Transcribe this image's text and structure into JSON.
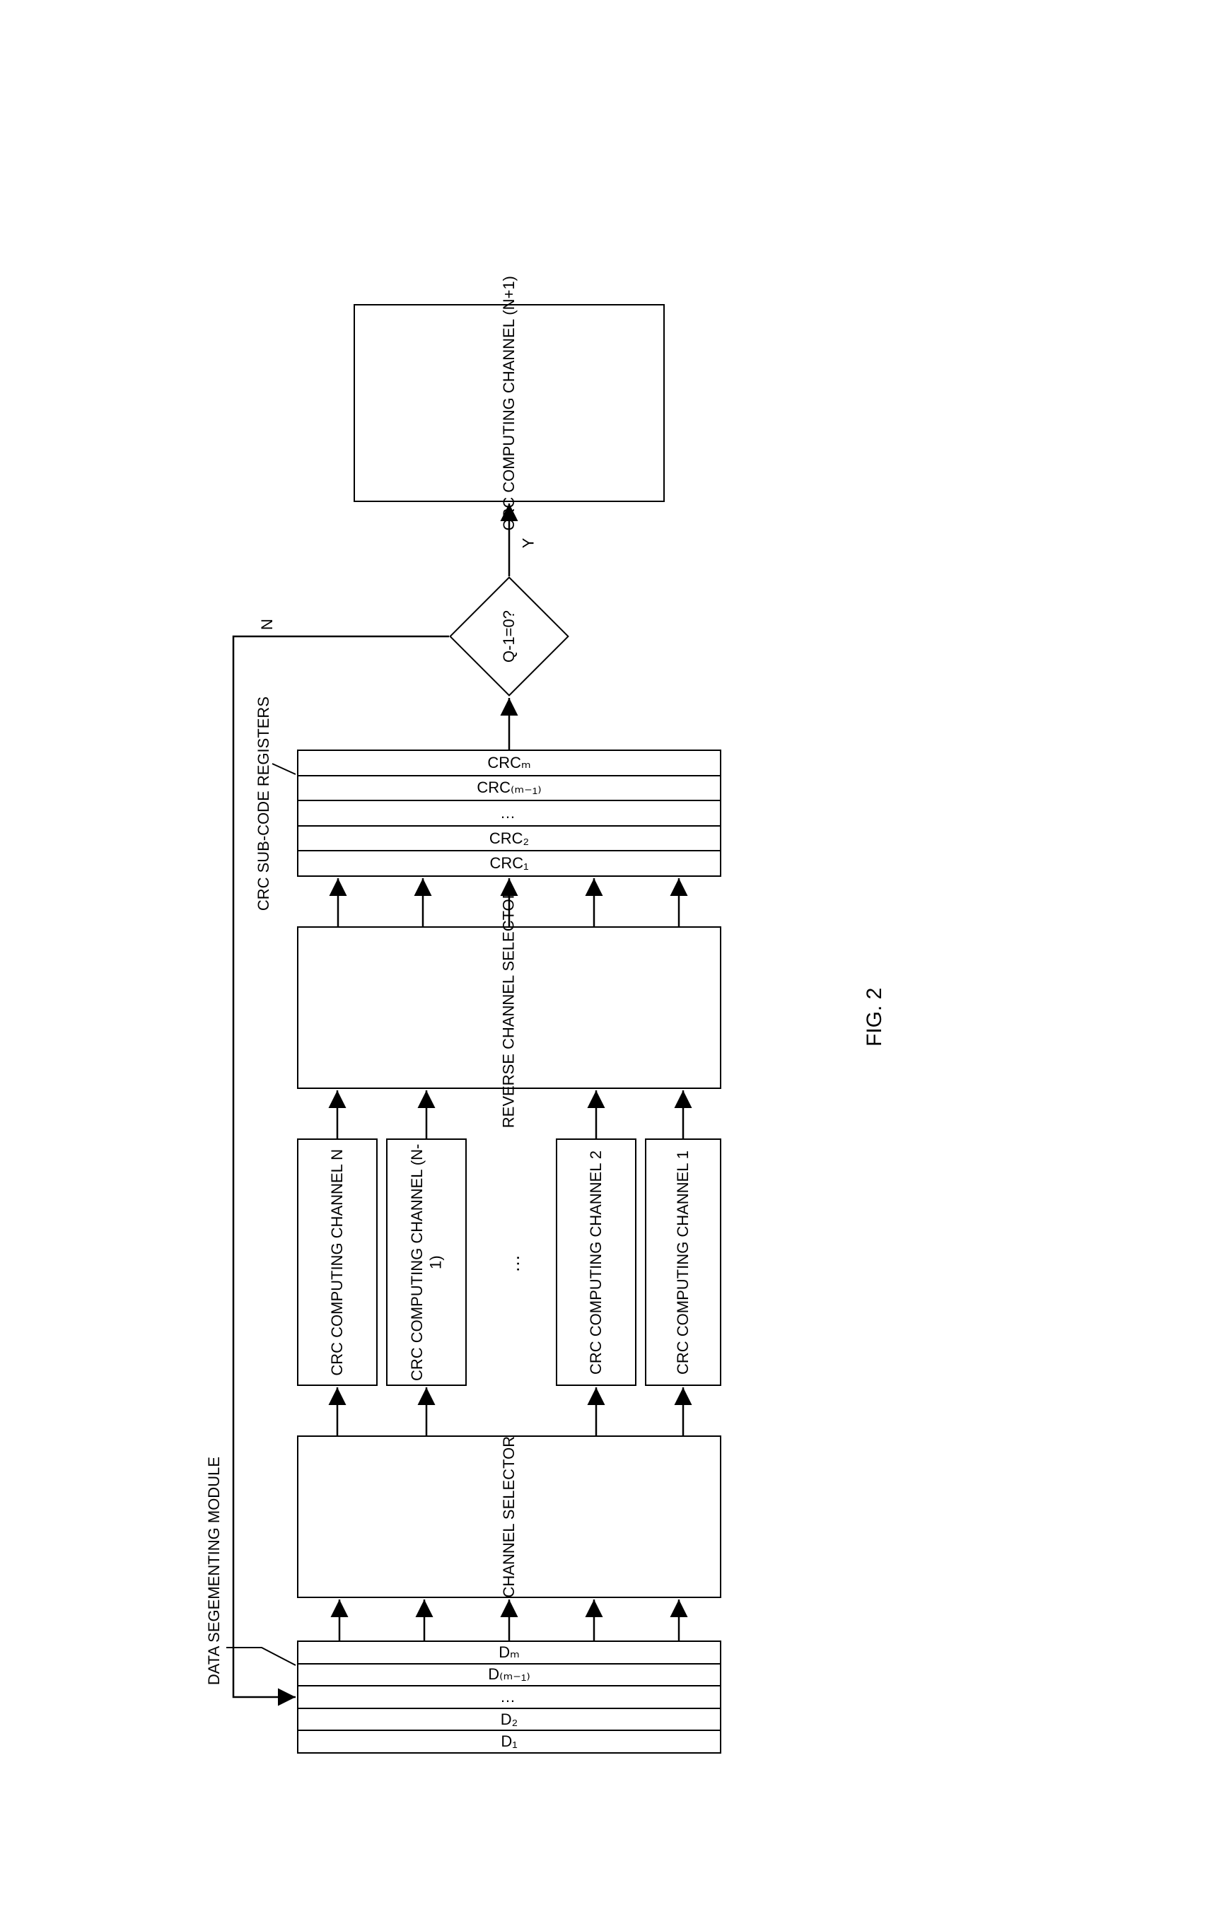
{
  "figure_caption": "FIG. 2",
  "module_label": "DATA SEGEMENTING MODULE",
  "registers_label": "CRC SUB-CODE REGISTERS",
  "data_segments": {
    "items": [
      "Dₘ",
      "D₍ₘ₋₁₎",
      "…",
      "D₂",
      "D₁"
    ]
  },
  "channel_selector": "CHANNEL SELECTOR",
  "reverse_channel_selector": "REVERSE CHANNEL SELECTOR",
  "crc_channels": {
    "items": [
      "CRC COMPUTING CHANNEL N",
      "CRC COMPUTING CHANNEL (N-1)",
      "…",
      "CRC COMPUTING CHANNEL 2",
      "CRC COMPUTING CHANNEL 1"
    ]
  },
  "crc_subcodes": {
    "items": [
      "CRCₘ",
      "CRC₍ₘ₋₁₎",
      "…",
      "CRC₂",
      "CRC₁"
    ]
  },
  "decision": "Q-1=0?",
  "branch_no": "N",
  "branch_yes": "Y",
  "final_channel": "CRC COMPUTING CHANNEL (N+1)",
  "chart_data": {
    "type": "flow-diagram",
    "nodes": [
      {
        "id": "segments",
        "label": "Data segmenting module",
        "items": [
          "D_m",
          "D_(m-1)",
          "...",
          "D_2",
          "D_1"
        ]
      },
      {
        "id": "selector",
        "label": "CHANNEL SELECTOR"
      },
      {
        "id": "channels",
        "label": "CRC computing channels",
        "items": [
          "N",
          "N-1",
          "...",
          "2",
          "1"
        ]
      },
      {
        "id": "rev_selector",
        "label": "REVERSE CHANNEL SELECTOR"
      },
      {
        "id": "registers",
        "label": "CRC sub-code registers",
        "items": [
          "CRC_m",
          "CRC_(m-1)",
          "...",
          "CRC_2",
          "CRC_1"
        ]
      },
      {
        "id": "decision",
        "label": "Q-1=0?"
      },
      {
        "id": "final",
        "label": "CRC COMPUTING CHANNEL (N+1)"
      }
    ],
    "edges": [
      {
        "from": "segments",
        "to": "selector",
        "count": 5
      },
      {
        "from": "selector",
        "to": "channels",
        "count": 5
      },
      {
        "from": "channels",
        "to": "rev_selector",
        "count": 5
      },
      {
        "from": "rev_selector",
        "to": "registers",
        "count": 5
      },
      {
        "from": "registers",
        "to": "decision"
      },
      {
        "from": "decision",
        "to": "final",
        "label": "Y"
      },
      {
        "from": "decision",
        "to": "segments",
        "label": "N"
      }
    ]
  }
}
